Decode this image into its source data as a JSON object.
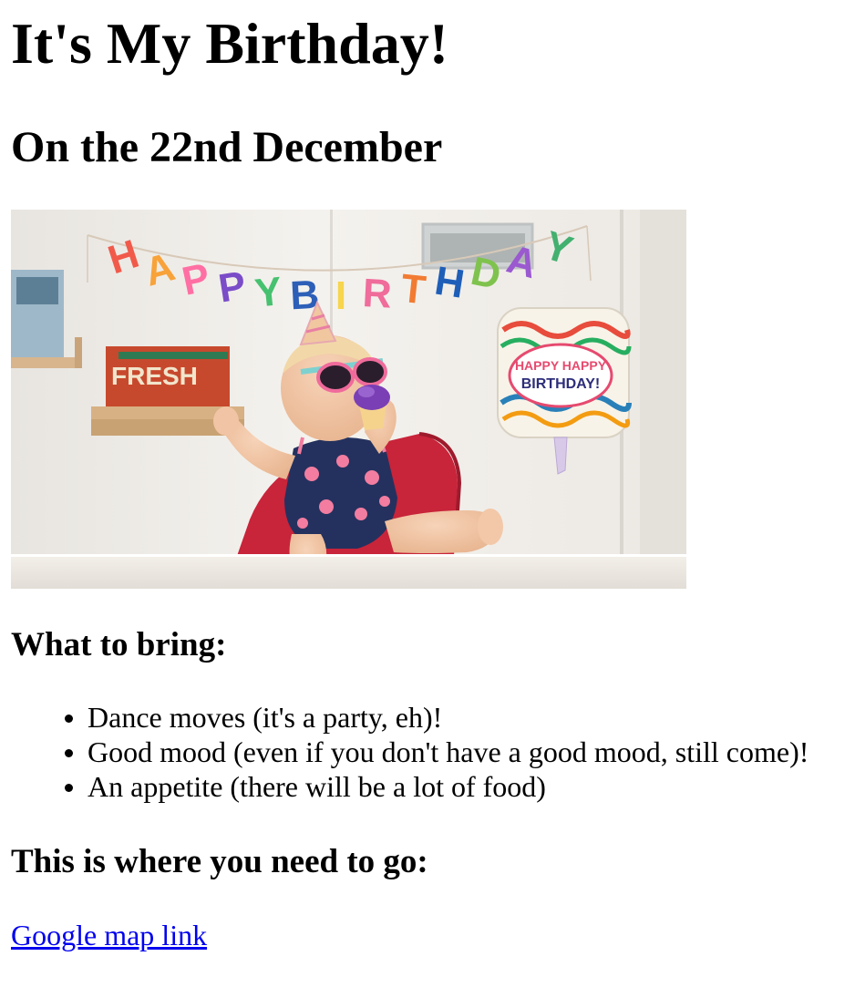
{
  "page": {
    "title": "It's My Birthday!",
    "subtitle": "On the 22nd December"
  },
  "photo": {
    "alt": "Baby in sunglasses eating a cupcake under a Happy Birthday banner",
    "banner_letters": [
      "H",
      "A",
      "P",
      "P",
      "Y",
      "B",
      "I",
      "R",
      "T",
      "H",
      "D",
      "A",
      "Y"
    ],
    "banner_colors": [
      "#f15a4a",
      "#f8a23a",
      "#ff6fa3",
      "#7a4cc8",
      "#46c16f",
      "#2d5fb8",
      "#f7d54d",
      "#ef6c9b",
      "#f27b32",
      "#1e5eb8",
      "#7fc34e",
      "#9b59d0",
      "#42b06f"
    ],
    "sign_text": "FRESH",
    "balloon_text_line1": "HAPPY HAPPY",
    "balloon_text_line2": "BIRTHDAY!"
  },
  "bring": {
    "heading": "What to bring:",
    "items": [
      "Dance moves (it's a party, eh)!",
      "Good mood (even if you don't have a good mood, still come)!",
      "An appetite (there will be a lot of food)"
    ]
  },
  "directions": {
    "heading": "This is where you need to go:",
    "link_text": "Google map link"
  },
  "colors": {
    "link": "#0000ee",
    "text": "#000000"
  }
}
